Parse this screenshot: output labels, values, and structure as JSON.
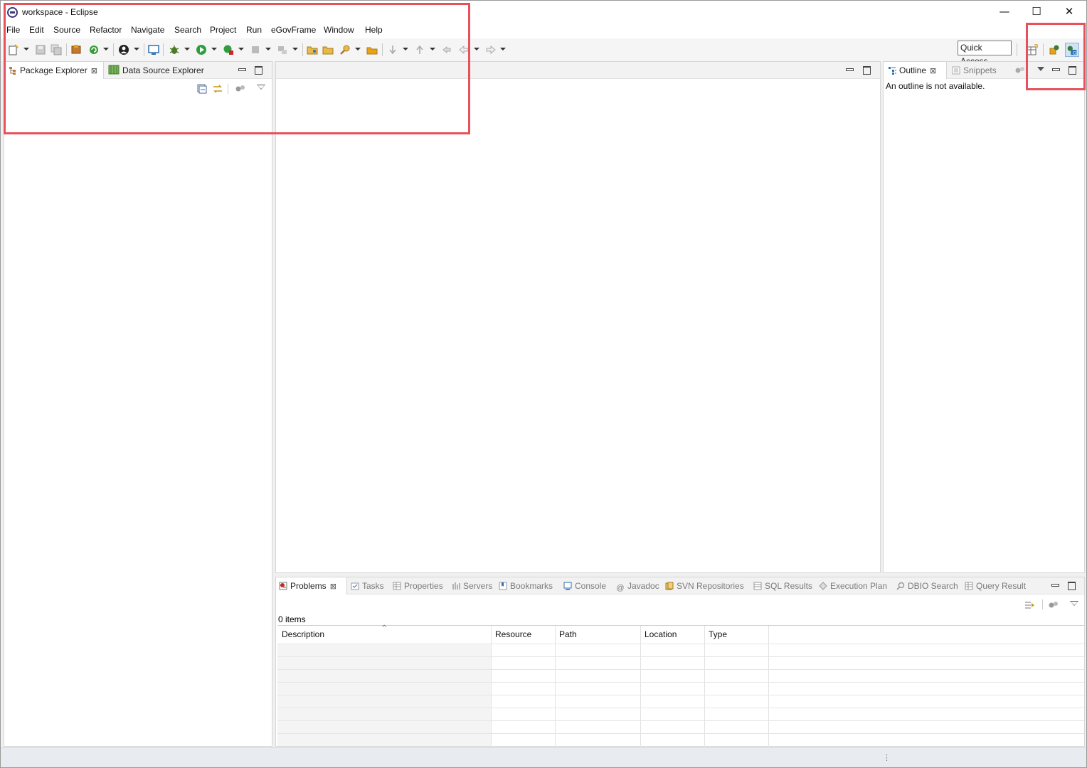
{
  "window": {
    "title": "workspace - Eclipse",
    "controls": {
      "minimize": "—",
      "maximize": "☐",
      "close": "✕"
    }
  },
  "menu": [
    "File",
    "Edit",
    "Source",
    "Refactor",
    "Navigate",
    "Search",
    "Project",
    "Run",
    "eGovFrame",
    "Window",
    "Help"
  ],
  "toolbar": {
    "quick_access": "Quick Access",
    "icons": [
      "new-icon",
      "save-icon",
      "save-all-icon",
      "new-project-icon",
      "refresh-icon",
      "person-icon",
      "terminal-icon",
      "debug-icon",
      "run-icon",
      "external-tools-icon",
      "stop-icon",
      "build-icon",
      "open-folder-icon",
      "open-type-icon",
      "search-icon",
      "task-icon",
      "next-annotation-icon",
      "prev-annotation-icon",
      "last-edit-icon",
      "back-icon",
      "forward-icon",
      "open-perspective-icon",
      "java-perspective-icon",
      "egov-perspective-icon"
    ]
  },
  "left_panel": {
    "tabs": [
      {
        "label": "Package Explorer",
        "icon": "package-explorer-icon",
        "active": true
      },
      {
        "label": "Data Source Explorer",
        "icon": "data-source-icon",
        "active": false
      }
    ]
  },
  "outline_panel": {
    "tabs": [
      {
        "label": "Outline",
        "icon": "outline-icon",
        "active": true
      },
      {
        "label": "Snippets",
        "icon": "snippets-icon",
        "active": false
      }
    ],
    "message": "An outline is not available."
  },
  "bottom_panel": {
    "tabs": [
      {
        "label": "Problems",
        "icon": "problems-icon",
        "active": true
      },
      {
        "label": "Tasks",
        "icon": "tasks-icon"
      },
      {
        "label": "Properties",
        "icon": "properties-icon"
      },
      {
        "label": "Servers",
        "icon": "servers-icon"
      },
      {
        "label": "Bookmarks",
        "icon": "bookmarks-icon"
      },
      {
        "label": "Console",
        "icon": "console-icon"
      },
      {
        "label": "Javadoc",
        "icon": "javadoc-icon"
      },
      {
        "label": "SVN Repositories",
        "icon": "svn-icon"
      },
      {
        "label": "SQL Results",
        "icon": "sql-results-icon"
      },
      {
        "label": "Execution Plan",
        "icon": "execution-plan-icon"
      },
      {
        "label": "DBIO Search",
        "icon": "dbio-search-icon"
      },
      {
        "label": "Query Result",
        "icon": "query-result-icon"
      }
    ],
    "items_count": "0 items",
    "columns": [
      "Description",
      "Resource",
      "Path",
      "Location",
      "Type"
    ]
  },
  "colors": {
    "highlight": "#e8505b",
    "accent": "#2f6fb3"
  }
}
